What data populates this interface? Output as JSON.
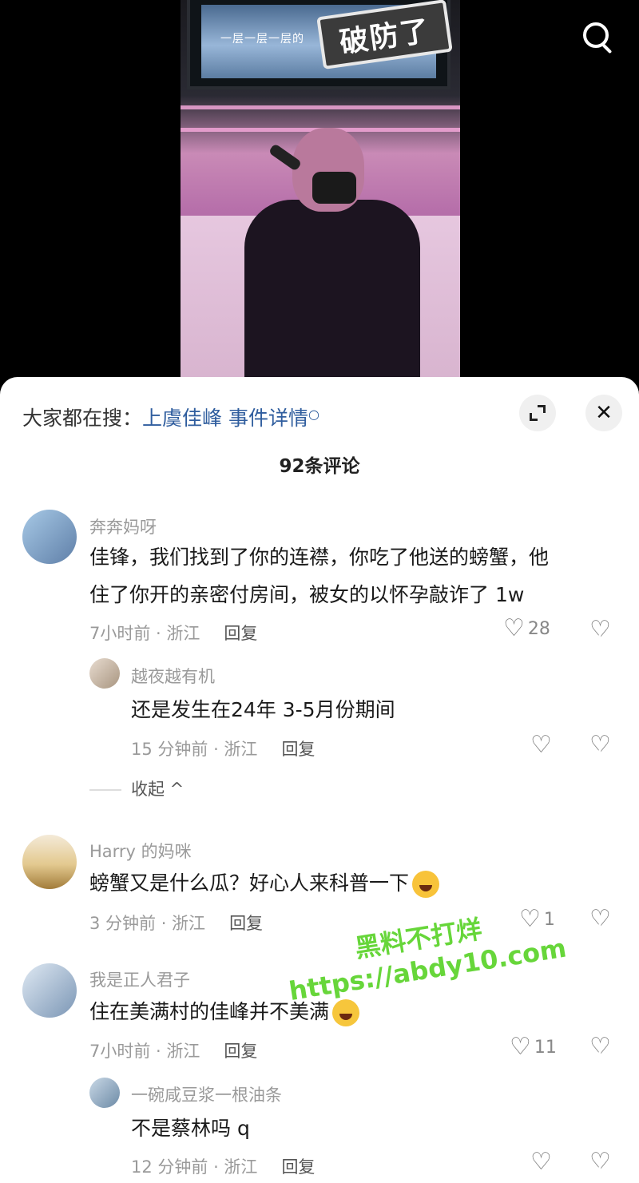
{
  "video": {
    "tv_caption": "一层一层一层的",
    "sticker_text": "破防了"
  },
  "panel": {
    "hot_search_prefix": "大家都在搜：",
    "hot_search_link": "上虞佳峰 事件详情",
    "comment_count": "92条评论",
    "close_glyph": "✕"
  },
  "comments": [
    {
      "name": "奔奔妈呀",
      "text_line1": "佳锋，我们找到了你的连襟，你吃了他送的螃蟹，他",
      "text_line2": "住了你开的亲密付房间，被女的以怀孕敲诈了 1w",
      "meta": "7小时前 · 浙江",
      "reply_label": "回复",
      "likes": "28",
      "replies": [
        {
          "name": "越夜越有机",
          "text": "还是发生在24年 3-5月份期间",
          "meta": "15 分钟前 · 浙江",
          "reply_label": "回复",
          "likes": ""
        }
      ],
      "collapse_label": "收起 ^"
    },
    {
      "name": "Harry 的妈咪",
      "text": "螃蟹又是什么瓜？好心人来科普一下",
      "meta": "3 分钟前 · 浙江",
      "reply_label": "回复",
      "likes": "1"
    },
    {
      "name": "我是正人君子",
      "text": "住在美满村的佳峰并不美满",
      "meta": "7小时前 · 浙江",
      "reply_label": "回复",
      "likes": "11",
      "replies": [
        {
          "name": "一碗咸豆浆一根油条",
          "text": "不是蔡林吗 q",
          "meta": "12 分钟前 · 浙江",
          "reply_label": "回复",
          "likes": ""
        }
      ]
    }
  ],
  "watermark": {
    "line1": "黑料不打烊",
    "line2": "https://abdy10.com"
  },
  "icons": {
    "heart": "♡",
    "dislike": "♡"
  }
}
